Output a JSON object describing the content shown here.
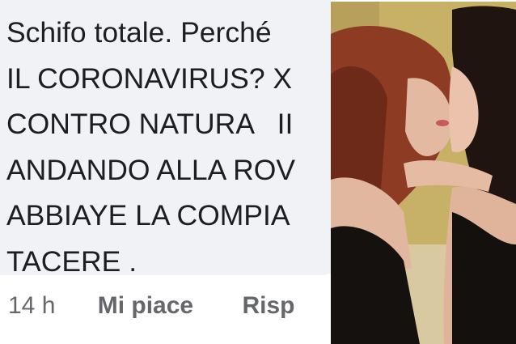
{
  "comment": {
    "lines": [
      "Schifo totale. Perché",
      "IL CORONAVIRUS? X",
      "CONTRO NATURA   II",
      "ANDANDO ALLA ROV",
      "ABBIAYE LA COMPIA",
      "TACERE ."
    ],
    "timestamp": "14 h",
    "like_label": "Mi piace",
    "reply_label": "Risp"
  },
  "photo": {
    "subject": "two-women-kissing-photo",
    "palette": {
      "wall": "#c9b46a",
      "hair_red": "#8e3b24",
      "hair_dark": "#1f1410",
      "skin": "#e2b79f",
      "clothing": "#15110f"
    }
  }
}
